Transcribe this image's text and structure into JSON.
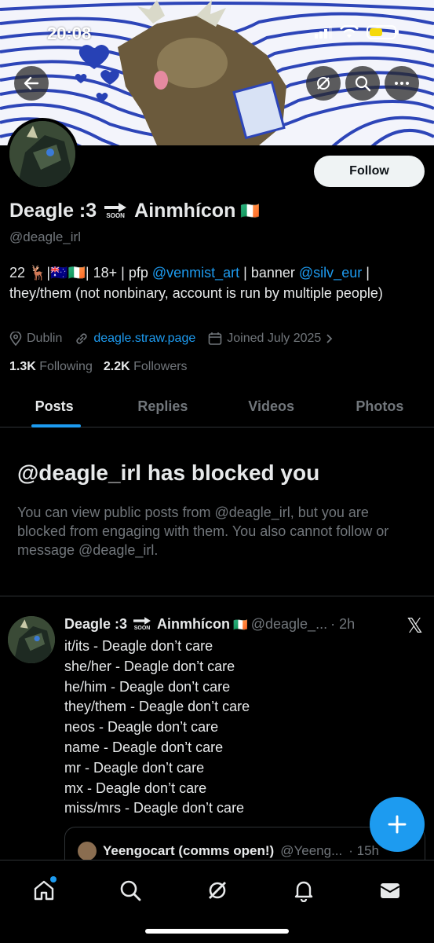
{
  "status_bar": {
    "time": "20:08"
  },
  "profile": {
    "display_name_part1": "Deagle :3",
    "soon_label": "SOON",
    "display_name_part2": "Ainmhícon",
    "flag": "🇮🇪",
    "handle": "@deagle_irl",
    "follow_label": "Follow",
    "bio": {
      "prefix": "22 🦌|🇦🇺🇮🇪| 18+ | pfp ",
      "pfp_link": "@venmist_art",
      "middle": " | banner ",
      "banner_link": "@silv_eur",
      "suffix": " | they/them (not nonbinary, account is run by multiple people)"
    },
    "location": "Dublin",
    "website": "deagle.straw.page",
    "joined": "Joined July 2025",
    "following_count": "1.3K",
    "following_label": "Following",
    "followers_count": "2.2K",
    "followers_label": "Followers"
  },
  "tabs": [
    {
      "label": "Posts"
    },
    {
      "label": "Replies"
    },
    {
      "label": "Videos"
    },
    {
      "label": "Photos"
    }
  ],
  "blocked": {
    "title": "@deagle_irl has blocked you",
    "description": "You can view public posts from @deagle_irl, but you are blocked from engaging with them. You also cannot follow or message @deagle_irl."
  },
  "post": {
    "name_part1": "Deagle :3",
    "name_part2": "Ainmhícon",
    "flag": "🇮🇪",
    "handle": "@deagle_...",
    "time": "· 2h",
    "lines": [
      "it/its - Deagle don’t care",
      "she/her - Deagle don’t care",
      "he/him - Deagle don’t care",
      "they/them - Deagle don’t care",
      "neos - Deagle don’t care",
      "name - Deagle don’t care",
      "mr - Deagle don’t care",
      "mx - Deagle don’t care",
      "miss/mrs - Deagle don’t care"
    ],
    "quote": {
      "name": "Yeengocart (comms open!)",
      "handle": "@Yeeng...",
      "time": "· 15h"
    }
  },
  "colors": {
    "accent": "#1d9bf0",
    "background": "#000000",
    "muted": "#71767b"
  }
}
